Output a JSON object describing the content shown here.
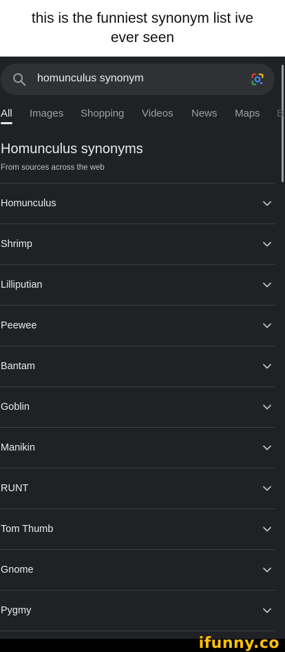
{
  "caption": "this is the funniest synonym list ive ever seen",
  "search": {
    "query": "homunculus synonym"
  },
  "tabs": [
    {
      "label": "All",
      "active": true
    },
    {
      "label": "Images"
    },
    {
      "label": "Shopping"
    },
    {
      "label": "Videos"
    },
    {
      "label": "News"
    },
    {
      "label": "Maps"
    },
    {
      "label": "B"
    }
  ],
  "result": {
    "title": "Homunculus synonyms",
    "subtitle": "From sources across the web",
    "items": [
      "Homunculus",
      "Shrimp",
      "Lilliputian",
      "Peewee",
      "Bantam",
      "Goblin",
      "Manikin",
      "RUNT",
      "Tom Thumb",
      "Gnome",
      "Pygmy"
    ]
  },
  "watermark": "ifunny.co",
  "icons": {
    "search": "search-icon",
    "lens": "google-lens-icon",
    "chevron": "chevron-down-icon"
  },
  "colors": {
    "background": "#202124",
    "text": "#e8eaed",
    "muted": "#9aa0a6",
    "watermark": "#ffc107"
  }
}
